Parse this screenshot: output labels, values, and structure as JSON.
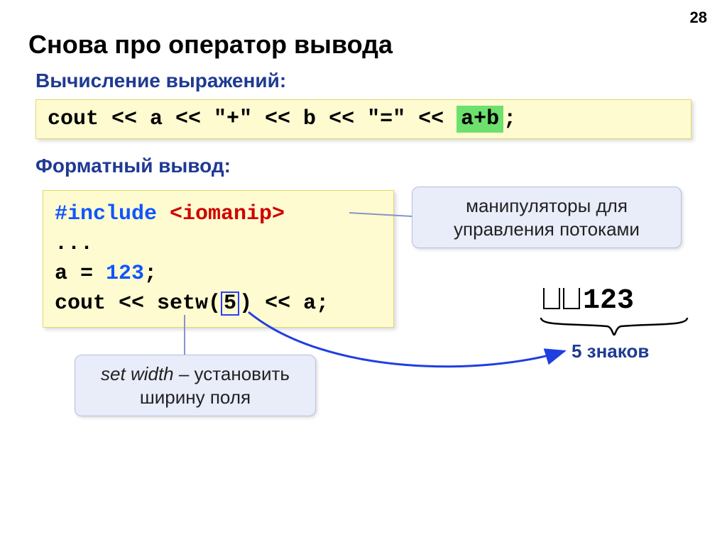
{
  "page_number": "28",
  "title": "Снова про оператор вывода",
  "section1": "Вычисление выражений:",
  "code1": {
    "prefix": "cout << a << \"+\" << b << \"=\" << ",
    "highlight": "a+b",
    "suffix": ";"
  },
  "section2": "Форматный вывод:",
  "code2": {
    "l1a": "#include ",
    "l1b": "<iomanip>",
    "l2": "...",
    "l3a": "a = ",
    "l3b": "123",
    "l3c": ";",
    "l4a": "cout << setw(",
    "l4b": "5",
    "l4c": ") << a;"
  },
  "callout_top": {
    "line1": "манипуляторы для",
    "line2": "управления потоками"
  },
  "callout_bottom": {
    "line1_em": "set width",
    "line1_rest": " – установить",
    "line2": "ширину поля"
  },
  "output_num": "123",
  "brace_label": "5 знаков"
}
